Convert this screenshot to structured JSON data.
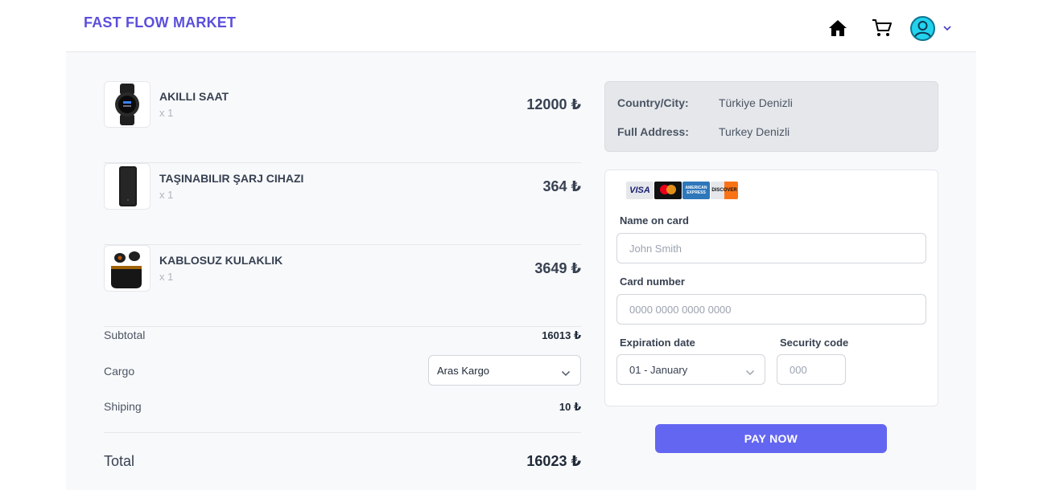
{
  "header": {
    "brand": "FAST FLOW MARKET",
    "icons": [
      "home-icon",
      "cart-icon",
      "avatar-icon",
      "chevron-down-icon"
    ]
  },
  "cart": {
    "items": [
      {
        "name": "AKILLI SAAT",
        "qty": "x 1",
        "price": "12000 ₺",
        "image": "smartwatch-image"
      },
      {
        "name": "TAŞINABILIR ŞARJ CIHAZI",
        "qty": "x 1",
        "price": "364 ₺",
        "image": "powerbank-image"
      },
      {
        "name": "KABLOSUZ KULAKLIK",
        "qty": "x 1",
        "price": "3649 ₺",
        "image": "earbuds-image"
      }
    ]
  },
  "summary": {
    "subtotal_label": "Subtotal",
    "subtotal_value": "16013 ₺",
    "cargo_label": "Cargo",
    "cargo_selected": "Aras Kargo",
    "shipping_label": "Shiping",
    "shipping_value": "10 ₺",
    "total_label": "Total",
    "total_value": "16023 ₺"
  },
  "address": {
    "country_label": "Country/City:",
    "country_value": "Türkiye Denizli",
    "full_label": "Full Address:",
    "full_value": "Turkey Denizli"
  },
  "payment": {
    "card_logos": [
      "VISA",
      "mastercard",
      "AMERICAN EXPRESS",
      "DISCOVER"
    ],
    "name_label": "Name on card",
    "name_placeholder": "John Smith",
    "number_label": "Card number",
    "number_placeholder": "0000 0000 0000 0000",
    "exp_label": "Expiration date",
    "exp_selected": "01 - January",
    "cvc_label": "Security code",
    "cvc_placeholder": "000",
    "pay_button": "PAY NOW"
  },
  "colors": {
    "brand": "#5b4fdb",
    "pay_button": "#6366f1",
    "avatar": "#22d3ee"
  }
}
